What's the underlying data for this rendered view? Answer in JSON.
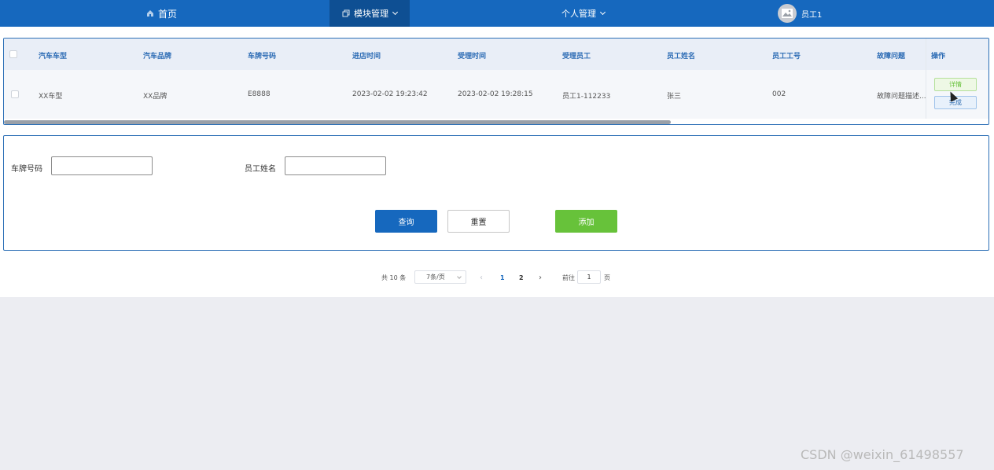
{
  "nav": {
    "home": "首页",
    "module": "模块管理",
    "personal": "个人管理",
    "user": "员工1"
  },
  "table": {
    "headers": [
      "汽车车型",
      "汽车品牌",
      "车牌号码",
      "进店时间",
      "受理时间",
      "受理员工",
      "员工姓名",
      "员工工号",
      "故障问题"
    ],
    "operation_header": "操作",
    "rows": [
      [
        "XX车型",
        "XX品牌",
        "E8888",
        "2023-02-02 19:23:42",
        "2023-02-02 19:28:15",
        "员工1-112233",
        "张三",
        "002",
        "故障问题描述..."
      ]
    ],
    "detail_label": "详情",
    "complete_label": "完成"
  },
  "search": {
    "plate_label": "车牌号码",
    "plate_value": "",
    "name_label": "员工姓名",
    "name_value": "",
    "query": "查询",
    "reset": "重置",
    "add": "添加"
  },
  "pagination": {
    "total": "共 10 条",
    "page_size": "7条/页",
    "page1": "1",
    "page2": "2",
    "goto_prefix": "前往",
    "goto_value": "1",
    "goto_suffix": "页"
  },
  "watermark": "CSDN @weixin_61498557",
  "colors": {
    "primary": "#1668be",
    "success": "#67c23a",
    "header_text": "#2d6cb5"
  }
}
